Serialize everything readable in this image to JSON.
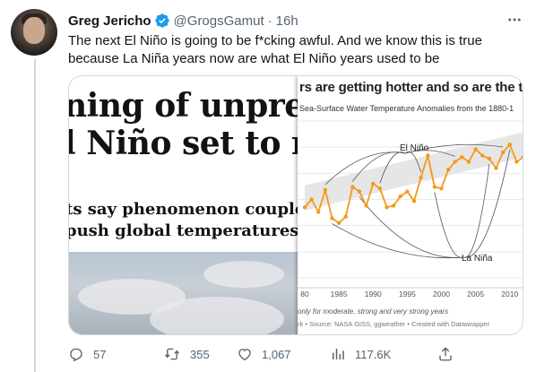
{
  "tweet": {
    "author_name": "Greg Jericho",
    "author_handle": "@GrogsGamut",
    "separator": "·",
    "time": "16h",
    "text": "The next El Niño is going to be f*cking awful. And we know this is true because La Niña years now are what El Niño years used to be",
    "verified": true
  },
  "media": {
    "left_image": {
      "headline_line_1": "ning of unprec",
      "headline_line_2": "l Niño set to re",
      "subhead_line_1": "ts say phenomenon couple",
      "subhead_line_2": "push global temperatures"
    },
    "right_image": {
      "title": "rs are getting hotter and so are the tro",
      "subtitle": "Sea-Surface Water Temperature Anomalies from the 1880-1",
      "label_el_nino": "El Niño",
      "label_la_nina": "La Niña",
      "note": "only for moderate, strong and very strong years",
      "source": "rk • Source: NASA GISS, ggweather • Created with Datawrapper"
    }
  },
  "chart_data": {
    "type": "line",
    "title": "rs are getting hotter and so are the tro",
    "subtitle": "Sea-Surface Water Temperature Anomalies from the 1880-1",
    "x_ticks": [
      "80",
      "1985",
      "1990",
      "1995",
      "2000",
      "2005",
      "2010"
    ],
    "xlim": [
      1980,
      2012
    ],
    "ylim": [
      0,
      1
    ],
    "grid": true,
    "series": [
      {
        "values": [
          [
            1980,
            0.45
          ],
          [
            1981,
            0.5
          ],
          [
            1982,
            0.42
          ],
          [
            1983,
            0.56
          ],
          [
            1984,
            0.38
          ],
          [
            1985,
            0.35
          ],
          [
            1986,
            0.39
          ],
          [
            1987,
            0.58
          ],
          [
            1988,
            0.55
          ],
          [
            1989,
            0.46
          ],
          [
            1990,
            0.6
          ],
          [
            1991,
            0.57
          ],
          [
            1992,
            0.45
          ],
          [
            1993,
            0.46
          ],
          [
            1994,
            0.52
          ],
          [
            1995,
            0.55
          ],
          [
            1996,
            0.49
          ],
          [
            1997,
            0.64
          ],
          [
            1998,
            0.78
          ],
          [
            1999,
            0.58
          ],
          [
            2000,
            0.57
          ],
          [
            2001,
            0.69
          ],
          [
            2002,
            0.74
          ],
          [
            2003,
            0.77
          ],
          [
            2004,
            0.74
          ],
          [
            2005,
            0.82
          ],
          [
            2006,
            0.78
          ],
          [
            2007,
            0.76
          ],
          [
            2008,
            0.7
          ],
          [
            2009,
            0.8
          ],
          [
            2010,
            0.85
          ],
          [
            2011,
            0.74
          ],
          [
            2012,
            0.77
          ]
        ],
        "color": "#f19a1b"
      }
    ],
    "annotations": [
      "El Niño",
      "La Niña"
    ]
  },
  "actions": {
    "reply_count": "57",
    "retweet_count": "355",
    "like_count": "1,067",
    "views_count": "117.6K"
  },
  "colors": {
    "text_primary": "#0f1419",
    "text_secondary": "#536471",
    "verified_blue": "#1d9bf0",
    "line_orange": "#f19a1b",
    "band_gray": "#e6e6e6"
  },
  "icons": {
    "verified": "verified-badge-icon",
    "more": "more-dots-icon",
    "reply": "reply-icon",
    "retweet": "retweet-icon",
    "like": "heart-icon",
    "views": "views-icon",
    "share": "share-icon"
  }
}
